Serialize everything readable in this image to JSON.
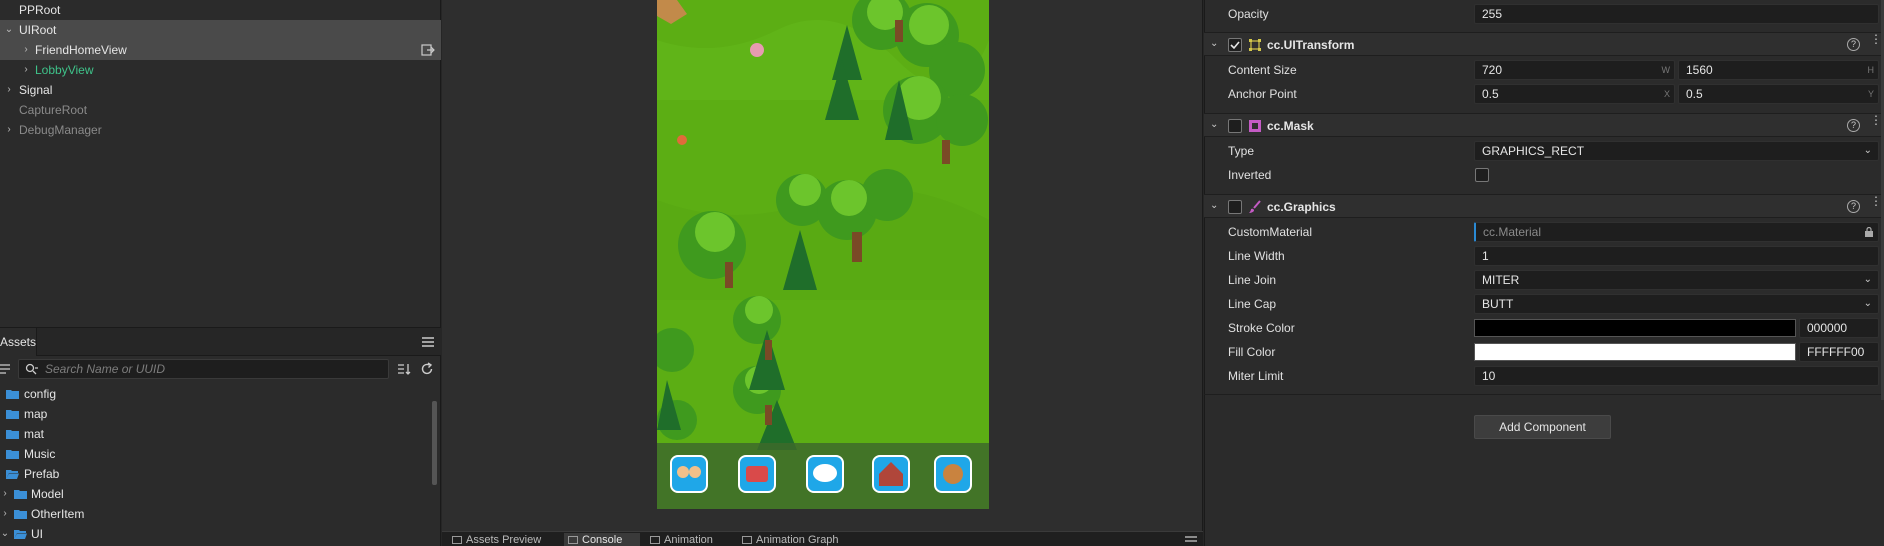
{
  "hierarchy": {
    "items": [
      {
        "label": "PPRoot"
      },
      {
        "label": "UIRoot"
      },
      {
        "label": "FriendHomeView"
      },
      {
        "label": "LobbyView"
      },
      {
        "label": "Signal"
      },
      {
        "label": "CaptureRoot"
      },
      {
        "label": "DebugManager"
      }
    ]
  },
  "assets": {
    "tab_label": "Assets",
    "search_placeholder": "Search Name or UUID",
    "items": [
      {
        "label": "config"
      },
      {
        "label": "map"
      },
      {
        "label": "mat"
      },
      {
        "label": "Music"
      },
      {
        "label": "Prefab"
      },
      {
        "label": "Model"
      },
      {
        "label": "OtherItem"
      },
      {
        "label": "UI"
      }
    ]
  },
  "bottom_tabs": [
    "Assets Preview",
    "Console",
    "Animation",
    "Animation Graph"
  ],
  "game_view": {
    "dock_icons": [
      "friends-icon",
      "shop-icon",
      "chat-icon",
      "house-icon",
      "squirrel-icon"
    ]
  },
  "inspector": {
    "opacity": {
      "label": "Opacity",
      "value": "255"
    },
    "ui_transform": {
      "title": "cc.UITransform",
      "content_size": {
        "label": "Content Size",
        "w": "720",
        "h": "1560",
        "w_unit": "W",
        "h_unit": "H"
      },
      "anchor_point": {
        "label": "Anchor Point",
        "x": "0.5",
        "y": "0.5",
        "x_unit": "X",
        "y_unit": "Y"
      }
    },
    "mask": {
      "title": "cc.Mask",
      "type": {
        "label": "Type",
        "value": "GRAPHICS_RECT"
      },
      "inverted": {
        "label": "Inverted"
      }
    },
    "graphics": {
      "title": "cc.Graphics",
      "custom_material": {
        "label": "CustomMaterial",
        "placeholder": "cc.Material"
      },
      "line_width": {
        "label": "Line Width",
        "value": "1"
      },
      "line_join": {
        "label": "Line Join",
        "value": "MITER"
      },
      "line_cap": {
        "label": "Line Cap",
        "value": "BUTT"
      },
      "stroke_color": {
        "label": "Stroke Color",
        "value": "000000",
        "color": "#000000"
      },
      "fill_color": {
        "label": "Fill Color",
        "value": "FFFFFF00",
        "color": "#ffffff"
      },
      "miter_limit": {
        "label": "Miter Limit",
        "value": "10"
      }
    },
    "add_component": "Add Component"
  },
  "colors": {
    "accent": "#2a8ad4",
    "selected_node": "#3fc38a",
    "folder": "#3b8fd6"
  }
}
